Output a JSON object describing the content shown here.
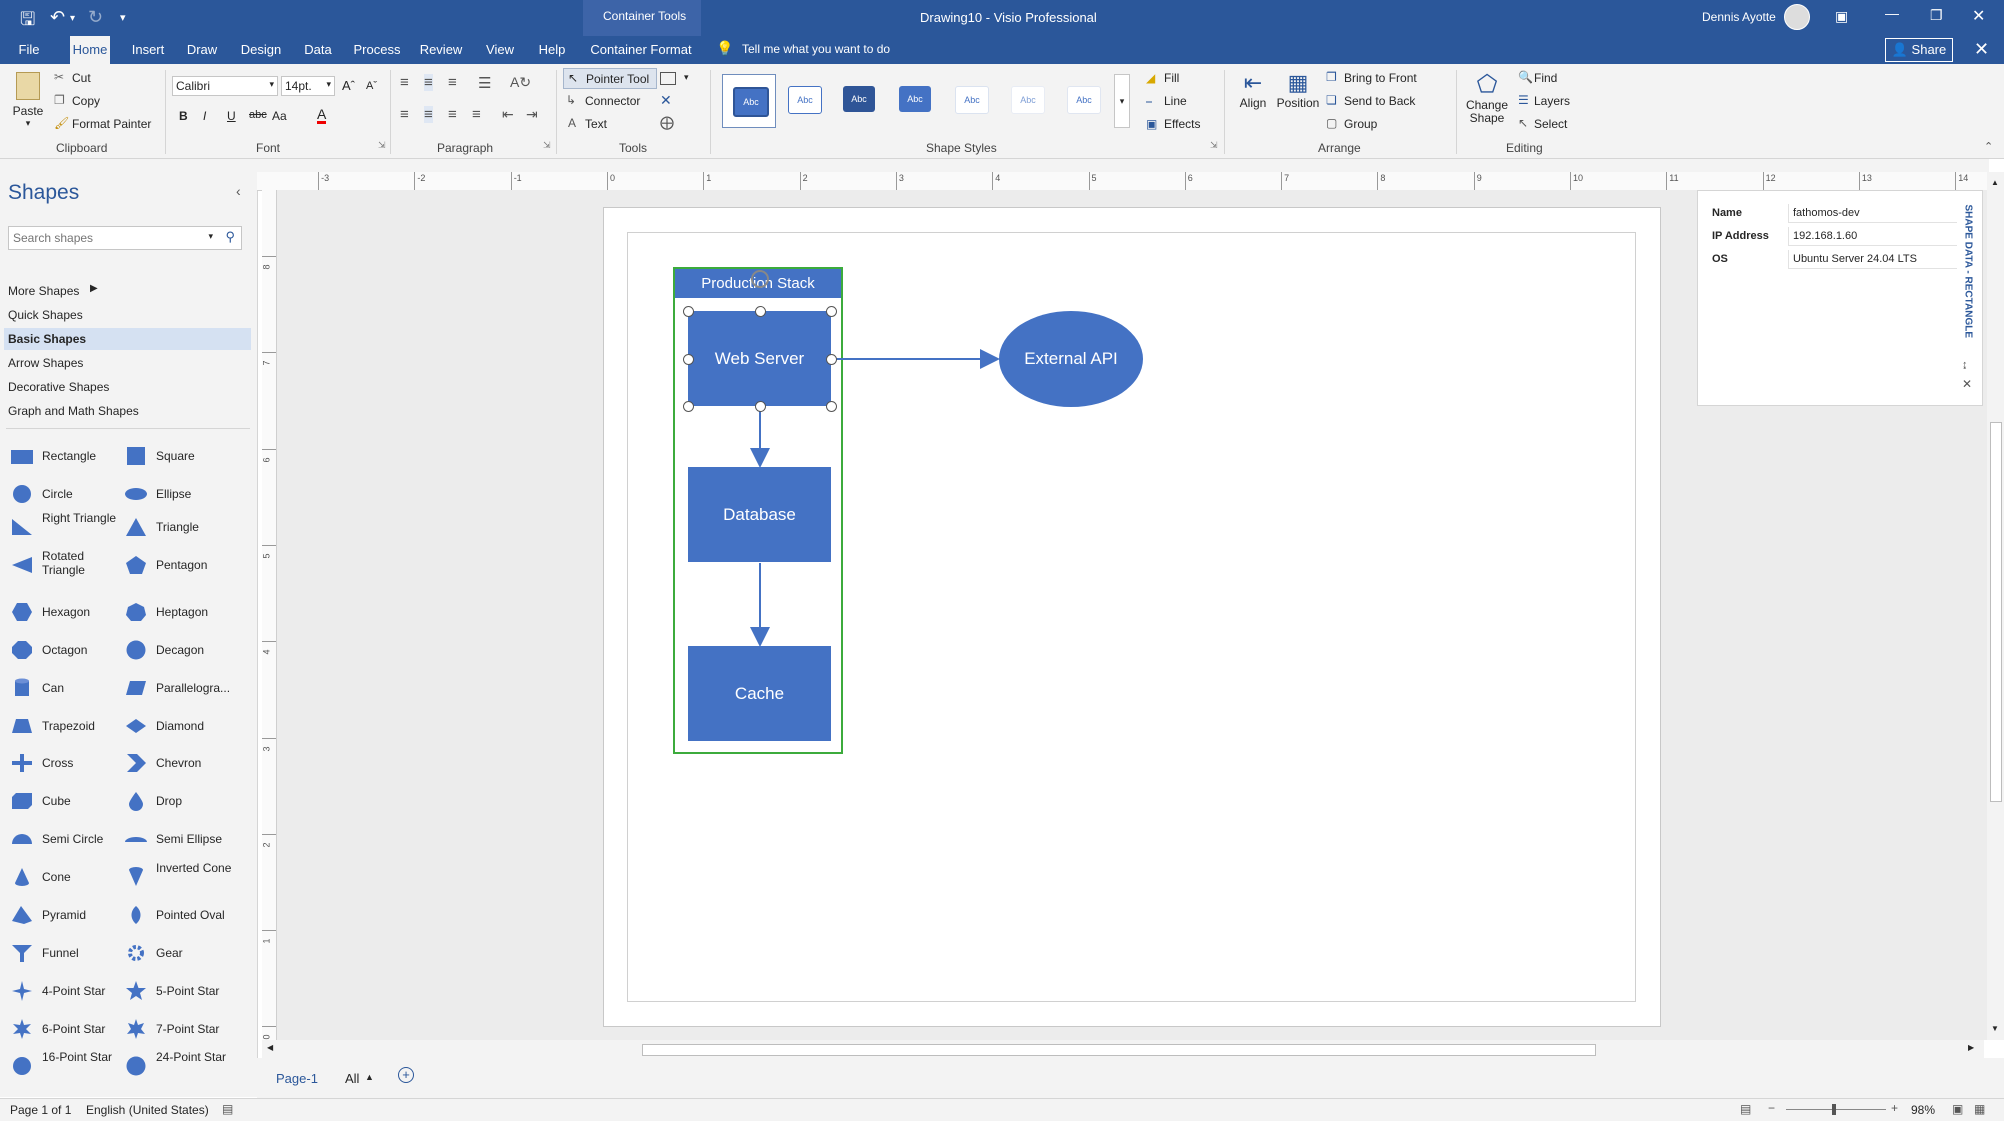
{
  "window": {
    "title": "Drawing10 - Visio Professional",
    "context_tools": "Container Tools",
    "user": "Dennis Ayotte",
    "share_label": "Share",
    "tell_me": "Tell me what you want to do"
  },
  "tabs": [
    "File",
    "Home",
    "Insert",
    "Draw",
    "Design",
    "Data",
    "Process",
    "Review",
    "View",
    "Help",
    "Container Format"
  ],
  "ribbon": {
    "clipboard": {
      "paste": "Paste",
      "cut": "Cut",
      "copy": "Copy",
      "format_painter": "Format Painter",
      "label": "Clipboard"
    },
    "font": {
      "family": "Calibri",
      "size": "14pt.",
      "label": "Font",
      "bold": "B",
      "italic": "I",
      "underline": "U",
      "strike": "abc",
      "case": "Aa"
    },
    "paragraph": {
      "label": "Paragraph"
    },
    "tools": {
      "pointer": "Pointer Tool",
      "connector": "Connector",
      "text": "Text",
      "label": "Tools"
    },
    "shape_styles": {
      "swatch": "Abc",
      "label": "Shape Styles",
      "fill": "Fill",
      "line": "Line",
      "effects": "Effects"
    },
    "arrange": {
      "align": "Align",
      "position": "Position",
      "bring_front": "Bring to Front",
      "send_back": "Send to Back",
      "group": "Group",
      "label": "Arrange"
    },
    "editing": {
      "change_shape_1": "Change",
      "change_shape_2": "Shape",
      "find": "Find",
      "layers": "Layers",
      "select": "Select",
      "label": "Editing"
    }
  },
  "shapes_panel": {
    "title": "Shapes",
    "search_placeholder": "Search shapes",
    "categories": [
      "More Shapes",
      "Quick Shapes",
      "Basic Shapes",
      "Arrow Shapes",
      "Decorative Shapes",
      "Graph and Math Shapes"
    ],
    "selected_category": "Basic Shapes",
    "stencil": [
      [
        "Rectangle",
        "Square"
      ],
      [
        "Circle",
        "Ellipse"
      ],
      [
        "Right Triangle",
        "Triangle"
      ],
      [
        "Rotated Triangle",
        "Pentagon"
      ],
      [
        "Hexagon",
        "Heptagon"
      ],
      [
        "Octagon",
        "Decagon"
      ],
      [
        "Can",
        "Parallelogra..."
      ],
      [
        "Trapezoid",
        "Diamond"
      ],
      [
        "Cross",
        "Chevron"
      ],
      [
        "Cube",
        "Drop"
      ],
      [
        "Semi Circle",
        "Semi Ellipse"
      ],
      [
        "Cone",
        "Inverted Cone"
      ],
      [
        "Pyramid",
        "Pointed Oval"
      ],
      [
        "Funnel",
        "Gear"
      ],
      [
        "4-Point Star",
        "5-Point Star"
      ],
      [
        "6-Point Star",
        "7-Point Star"
      ],
      [
        "16-Point Star",
        "24-Point Star"
      ]
    ]
  },
  "ruler": {
    "h_ticks": [
      "-3",
      "-2",
      "-1",
      "0",
      "1",
      "2",
      "3",
      "4",
      "5",
      "6",
      "7",
      "8",
      "9",
      "10",
      "11",
      "12",
      "13",
      "14"
    ],
    "v_ticks": [
      "8",
      "7",
      "6",
      "5",
      "4",
      "3",
      "2",
      "1",
      "0"
    ]
  },
  "diagram": {
    "container_title": "Production Stack",
    "nodes": {
      "web": "Web Server",
      "db": "Database",
      "cache": "Cache",
      "api": "External API"
    }
  },
  "shape_data": {
    "panel_title": "SHAPE DATA - RECTANGLE",
    "rows": [
      {
        "key": "Name",
        "value": "fathomos-dev"
      },
      {
        "key": "IP Address",
        "value": "192.168.1.60"
      },
      {
        "key": "OS",
        "value": "Ubuntu Server 24.04 LTS"
      }
    ]
  },
  "page_tabs": {
    "current": "Page-1",
    "all": "All"
  },
  "status": {
    "page": "Page 1 of 1",
    "language": "English (United States)",
    "zoom": "98%"
  },
  "colors": {
    "brand": "#2b579a",
    "shape_fill": "#4472c4",
    "container_border": "#3cab3c"
  }
}
